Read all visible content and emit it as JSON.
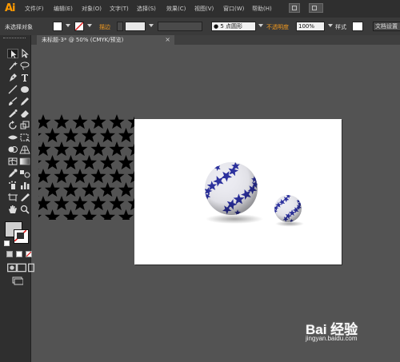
{
  "app": {
    "logo": "Ai"
  },
  "menu": [
    "文件(F)",
    "编辑(E)",
    "对象(O)",
    "文字(T)",
    "选择(S)",
    "效果(C)",
    "视图(V)",
    "窗口(W)",
    "帮助(H)"
  ],
  "control_bar": {
    "selection_status": "未选择对象",
    "stroke_label": "描边",
    "brush_value": "5 点圆形",
    "opacity_label": "不透明度",
    "opacity_value": "100%",
    "style_label": "样式",
    "doc_setup_label": "文档设置"
  },
  "document_tab": {
    "title": "未标题-3* @ 50% (CMYK/预览)",
    "close": "×"
  },
  "watermark": {
    "brand": "Bai 经验",
    "url": "jingyan.baidu.com"
  },
  "colors": {
    "accent": "#ff9a00",
    "sphere_blue": "#2a2f9e",
    "panel": "#2f2f2f",
    "canvas": "#535353"
  },
  "icons": [
    "selection-tool-icon",
    "direct-selection-tool-icon",
    "magic-wand-tool-icon",
    "lasso-tool-icon",
    "pen-tool-icon",
    "type-tool-icon",
    "line-tool-icon",
    "ellipse-tool-icon",
    "paintbrush-tool-icon",
    "pencil-tool-icon",
    "blob-brush-tool-icon",
    "eraser-tool-icon",
    "rotate-tool-icon",
    "scale-tool-icon",
    "width-tool-icon",
    "free-transform-tool-icon",
    "shape-builder-tool-icon",
    "perspective-grid-tool-icon",
    "mesh-tool-icon",
    "gradient-tool-icon",
    "eyedropper-tool-icon",
    "blend-tool-icon",
    "symbol-sprayer-tool-icon",
    "column-graph-tool-icon",
    "artboard-tool-icon",
    "slice-tool-icon",
    "hand-tool-icon",
    "zoom-tool-icon"
  ]
}
